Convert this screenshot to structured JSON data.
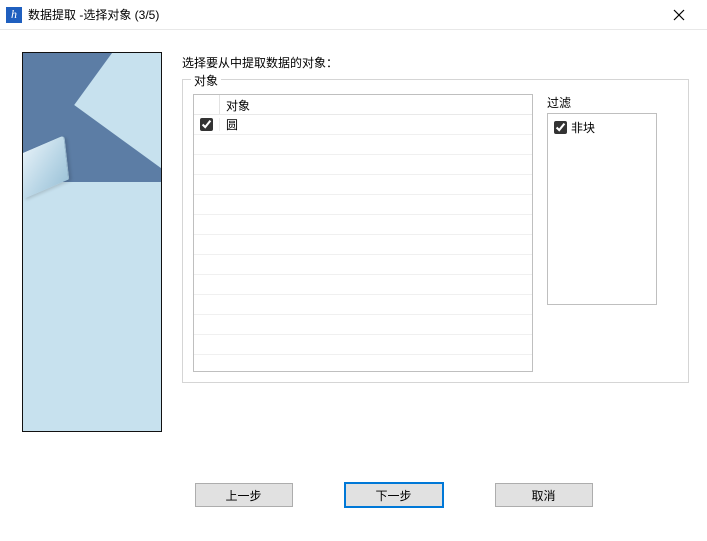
{
  "window": {
    "title": "数据提取 -选择对象 (3/5)"
  },
  "instruction": "选择要从中提取数据的对象：",
  "objectsGroup": {
    "label": "对象",
    "columnHeader": "对象",
    "rows": [
      {
        "checked": true,
        "name": "圆"
      }
    ]
  },
  "filterGroup": {
    "label": "过滤",
    "items": [
      {
        "checked": true,
        "name": "非块"
      }
    ]
  },
  "buttons": {
    "back": "上一步",
    "next": "下一步",
    "cancel": "取消"
  }
}
